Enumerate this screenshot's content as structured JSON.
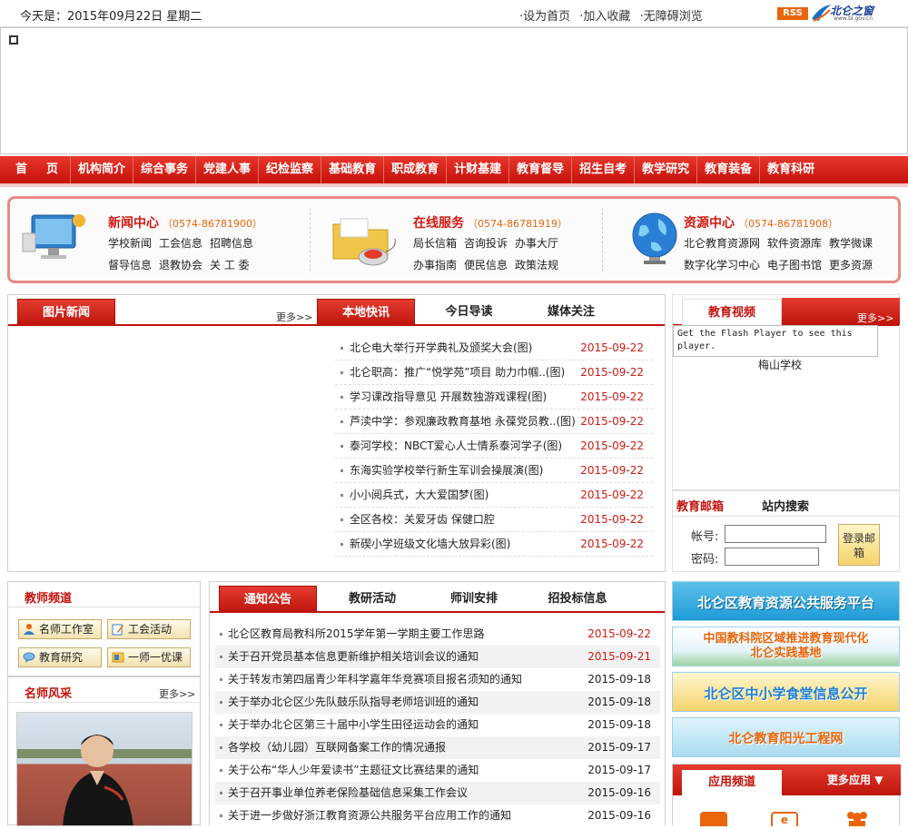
{
  "topbar": {
    "date": "今天是：2015年09月22日  星期二",
    "links": [
      "·设为首页",
      "·加入收藏",
      "·无障碍浏览"
    ],
    "rss": "RSS",
    "logo_text": "北仑之窗",
    "logo_url": "www.bl.gov.cn"
  },
  "nav": [
    "首　页",
    "机构简介",
    "综合事务",
    "党建人事",
    "纪检监察",
    "基础教育",
    "职成教育",
    "计财基建",
    "教育督导",
    "招生自考",
    "教学研究",
    "教育装备",
    "教育科研"
  ],
  "services": [
    {
      "title": "新闻中心",
      "phone": "（0574-86781900）",
      "row1": [
        "学校新闻",
        "工会信息",
        "招聘信息"
      ],
      "row2": [
        "督导信息",
        "退教协会",
        "关 工 委"
      ]
    },
    {
      "title": "在线服务",
      "phone": "（0574-86781919）",
      "row1": [
        "局长信箱",
        "咨询投诉",
        "办事大厅"
      ],
      "row2": [
        "办事指南",
        "便民信息",
        "政策法规"
      ]
    },
    {
      "title": "资源中心",
      "phone": "（0574-86781908）",
      "row1": [
        "北仑教育资源网",
        "软件资源库",
        "教学微课"
      ],
      "row2": [
        "数字化学习中心",
        "电子图书馆",
        "更多资源"
      ]
    }
  ],
  "picnews": {
    "tab": "图片新闻",
    "more": "更多>>"
  },
  "newstabs": [
    "本地快讯",
    "今日导读",
    "媒体关注"
  ],
  "news": [
    {
      "title": "北仑电大举行开学典礼及颁奖大会(图)",
      "date": "2015-09-22"
    },
    {
      "title": "北仑职高：推广“悦学苑”项目 助力巾帼..(图)",
      "date": "2015-09-22"
    },
    {
      "title": "学习课改指导意见 开展数独游戏课程(图)",
      "date": "2015-09-22"
    },
    {
      "title": "芦渎中学：参观廉政教育基地 永葆党员教..(图)",
      "date": "2015-09-22"
    },
    {
      "title": "泰河学校：NBCT爱心人士情系泰河学子(图)",
      "date": "2015-09-22"
    },
    {
      "title": "东海实验学校举行新生军训会操展演(图)",
      "date": "2015-09-22"
    },
    {
      "title": "小小阅兵式，大大爱国梦(图)",
      "date": "2015-09-22"
    },
    {
      "title": "全区各校：关爱牙齿 保健口腔",
      "date": "2015-09-22"
    },
    {
      "title": "新碶小学班级文化墙大放异彩(图)",
      "date": "2015-09-22"
    }
  ],
  "video": {
    "tab": "教育视频",
    "more": "更多>>",
    "flash": "Get the Flash Player to see this player.",
    "caption": "梅山学校"
  },
  "mail": {
    "tab1": "教育邮箱",
    "tab2": "站内搜索",
    "account": "帐号:",
    "password": "密码:",
    "login": "登录邮箱"
  },
  "teacher": {
    "title": "教师频道",
    "buttons": [
      "名师工作室",
      "工会活动",
      "教育研究",
      "一师一优课"
    ],
    "style_title": "名师风采",
    "more": "更多>>"
  },
  "noticetabs": [
    "通知公告",
    "教研活动",
    "师训安排",
    "招投标信息"
  ],
  "notices": [
    {
      "title": "北仑区教育局教科所2015学年第一学期主要工作思路",
      "date": "2015-09-22",
      "red": true
    },
    {
      "title": "关于召开党员基本信息更新维护相关培训会议的通知",
      "date": "2015-09-21",
      "red": true
    },
    {
      "title": "关于转发市第四届青少年科学嘉年华竞赛项目报名须知的通知",
      "date": "2015-09-18",
      "red": false
    },
    {
      "title": "关于举办北仑区少先队鼓乐队指导老师培训班的通知",
      "date": "2015-09-18",
      "red": false
    },
    {
      "title": "关于举办北仑区第三十届中小学生田径运动会的通知",
      "date": "2015-09-18",
      "red": false
    },
    {
      "title": "各学校（幼儿园）互联网备案工作的情况通报",
      "date": "2015-09-17",
      "red": false
    },
    {
      "title": "关于公布“华人少年爱读书”主题征文比赛结果的通知",
      "date": "2015-09-17",
      "red": false
    },
    {
      "title": "关于召开事业单位养老保险基础信息采集工作会议",
      "date": "2015-09-16",
      "red": false
    },
    {
      "title": "关于进一步做好浙江教育资源公共服务平台应用工作的通知",
      "date": "2015-09-16",
      "red": false
    }
  ],
  "banners": [
    "北仑区教育资源公共服务平台",
    "中国教科院区域推进教育现代化北仑实践基地",
    "北仑区中小学食堂信息公开",
    "北仑教育阳光工程网"
  ],
  "apps": {
    "tab": "应用频道",
    "more": "更多应用"
  },
  "colors": {
    "primary": "#c4120b",
    "accent": "#e8650c",
    "date_red": "#d01a12"
  }
}
